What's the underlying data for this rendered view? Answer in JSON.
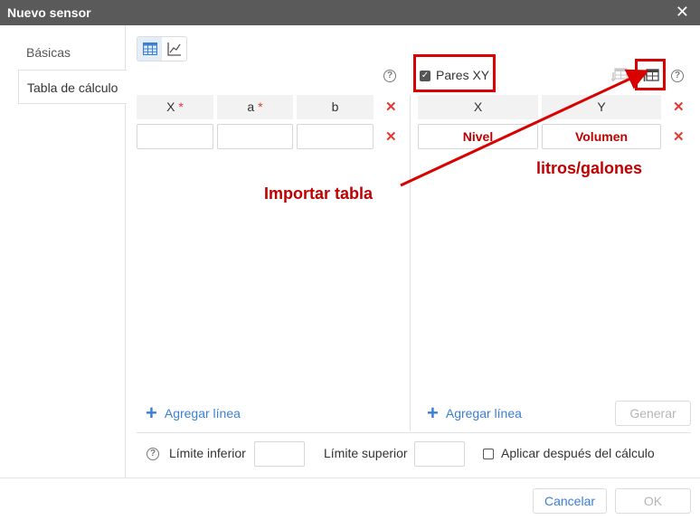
{
  "window": {
    "title": "Nuevo sensor",
    "close_glyph": "✕"
  },
  "sidebar": {
    "items": [
      {
        "label": "Básicas"
      },
      {
        "label": "Tabla de cálculo"
      }
    ]
  },
  "help_glyph": "?",
  "left_table": {
    "headers": [
      {
        "label": "X",
        "required": "*"
      },
      {
        "label": "a",
        "required": "*"
      },
      {
        "label": "b"
      }
    ],
    "delete_glyph": "✕",
    "add_line_label": "Agregar línea"
  },
  "right_table": {
    "pairs_label": "Pares XY",
    "check_glyph": "✓",
    "headers": [
      {
        "label": "X"
      },
      {
        "label": "Y"
      }
    ],
    "row_values": [
      "Nivel",
      "Volumen"
    ],
    "delete_glyph": "✕",
    "add_line_label": "Agregar línea",
    "generate_label": "Generar"
  },
  "bottom": {
    "lower_limit_label": "Límite inferior",
    "upper_limit_label": "Límite superior",
    "apply_after_label": "Aplicar después del cálculo"
  },
  "footer": {
    "cancel_label": "Cancelar",
    "ok_label": "OK"
  },
  "annotations": {
    "import_label": "Importar tabla",
    "units_label": "litros/galones"
  },
  "colors": {
    "accent": "#3a7fd5",
    "danger": "#e53935",
    "annotation_red": "#d90000"
  }
}
